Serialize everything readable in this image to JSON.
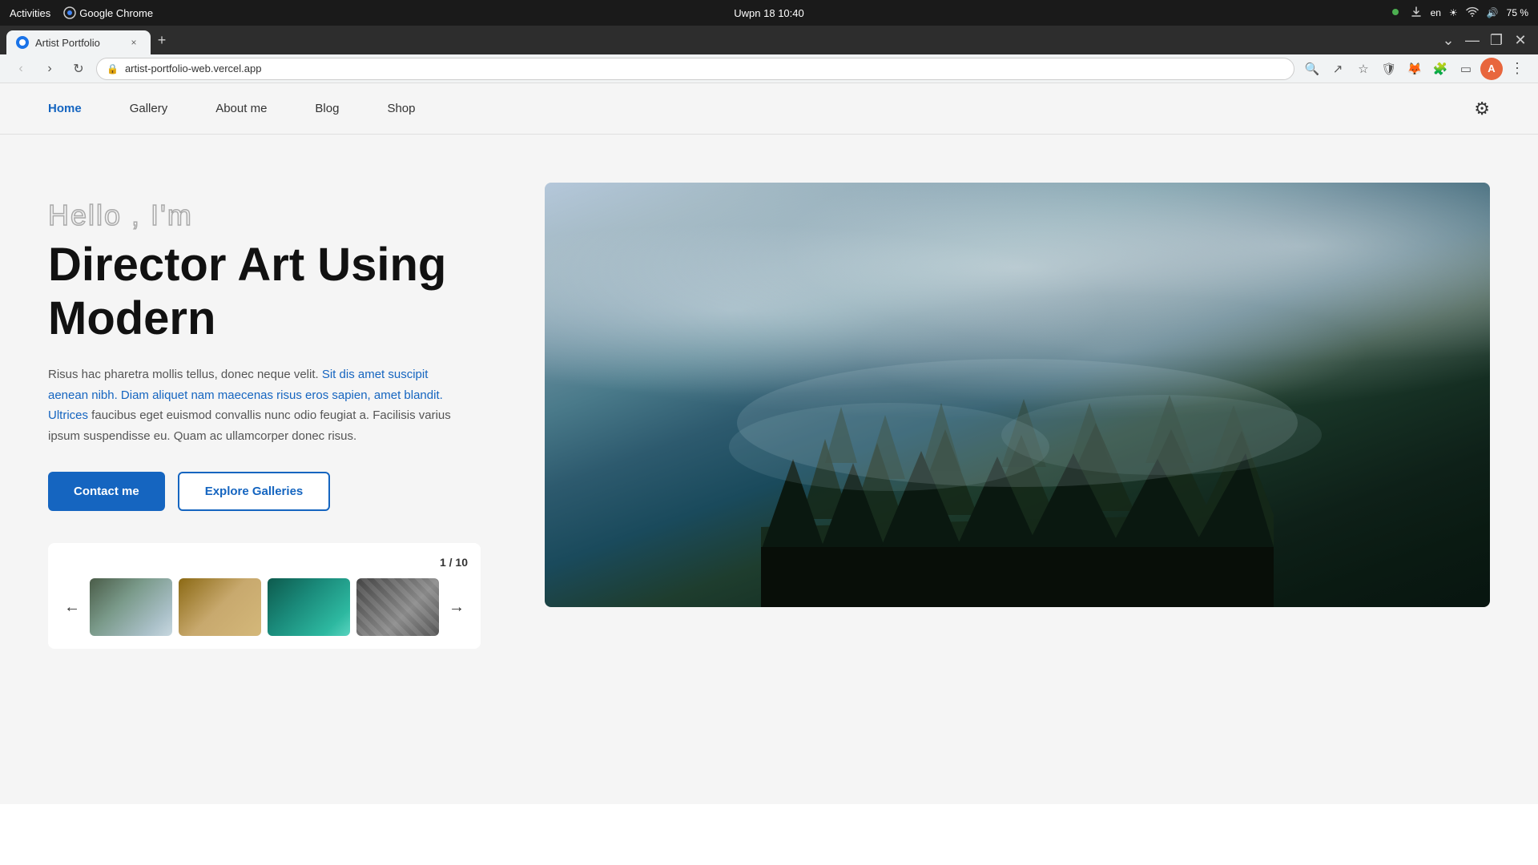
{
  "os": {
    "activities_label": "Activities",
    "browser_label": "Google Chrome",
    "time": "Uwpn 18  10:40",
    "lang": "en",
    "battery": "75 %"
  },
  "tab": {
    "title": "Artist Portfolio",
    "close": "×"
  },
  "new_tab_btn": "+",
  "window_controls": {
    "minimize": "—",
    "restore": "❐",
    "close": "✕"
  },
  "address_bar": {
    "url": "artist-portfolio-web.vercel.app",
    "lock_icon": "🔒"
  },
  "nav": {
    "links": [
      {
        "label": "Home",
        "active": true
      },
      {
        "label": "Gallery",
        "active": false
      },
      {
        "label": "About me",
        "active": false
      },
      {
        "label": "Blog",
        "active": false
      },
      {
        "label": "Shop",
        "active": false
      }
    ],
    "settings_icon": "⚙"
  },
  "hero": {
    "greeting": "Hello , I'm",
    "title_line1": "Director Art Using",
    "title_line2": "Modern",
    "description": "Risus hac pharetra mollis tellus, donec neque velit. Sit dis amet suscipit aenean nibh. Diam aliquet nam maecenas risus eros sapien, amet blandit. Ultrices faucibus eget euismod convallis nunc odio feugiat a. Facilisis varius ipsum suspendisse eu. Quam ac ullamcorper donec risus.",
    "btn_primary": "Contact me",
    "btn_outline": "Explore Galleries"
  },
  "gallery": {
    "current": "1",
    "total": "10",
    "separator": "/",
    "prev_icon": "←",
    "next_icon": "→",
    "thumbnails": [
      {
        "label": "forest-fog",
        "color1": "#4a6741",
        "color2": "#8faab8"
      },
      {
        "label": "desert-dunes",
        "color1": "#c8a96e",
        "color2": "#8b6914"
      },
      {
        "label": "tropical-aerial",
        "color1": "#1a8a7a",
        "color2": "#0d5a4d"
      },
      {
        "label": "architecture",
        "color1": "#555",
        "color2": "#888"
      }
    ]
  },
  "about": {
    "title": "About me"
  },
  "colors": {
    "nav_active": "#1565c0",
    "btn_primary_bg": "#1565c0",
    "btn_outline_border": "#1565c0"
  }
}
